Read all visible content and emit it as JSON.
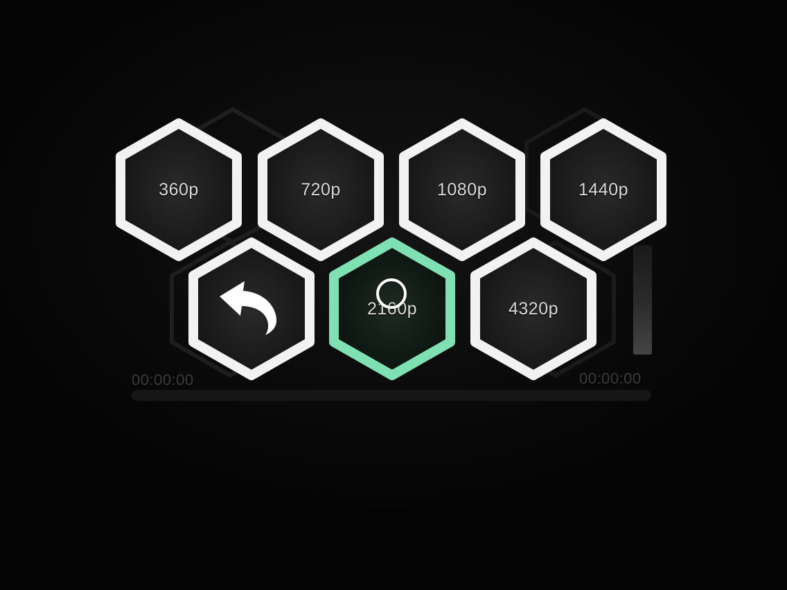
{
  "player": {
    "start_time": "00:00:00",
    "end_time": "00:00:00",
    "seek_progress": 0
  },
  "quality_menu": {
    "options": [
      {
        "label": "360p"
      },
      {
        "label": "720p"
      },
      {
        "label": "1080p"
      },
      {
        "label": "1440p"
      },
      {
        "label": "2160p",
        "selected": true
      },
      {
        "label": "4320p"
      }
    ],
    "back_icon": "back-arrow-icon"
  },
  "colors": {
    "background": "#050505",
    "hex_border": "#f2f2f2",
    "hex_fill": "#1c1c1c",
    "selected_border": "#7fe0b4",
    "selected_fill": "#122018",
    "label": "#d8d8d8",
    "time_text": "#3a3a3a"
  }
}
